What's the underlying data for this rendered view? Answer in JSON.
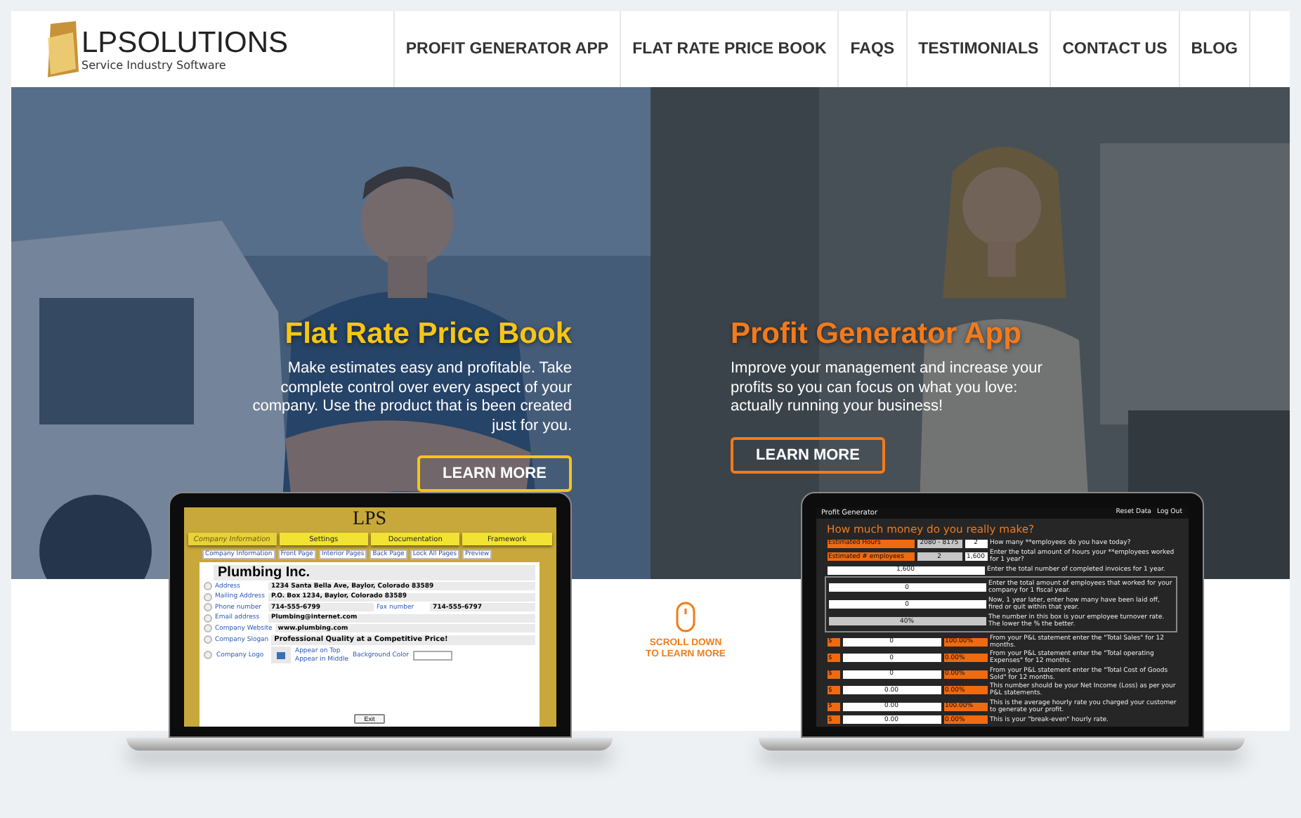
{
  "header": {
    "logo": {
      "wordmark": "LPSOLUTIONS",
      "tagline": "Service Industry Software"
    },
    "nav": [
      {
        "label": "PROFIT GENERATOR APP"
      },
      {
        "label": "FLAT RATE PRICE BOOK"
      },
      {
        "label": "FAQS"
      },
      {
        "label": "TESTIMONIALS"
      },
      {
        "label": "CONTACT US"
      },
      {
        "label": "BLOG"
      }
    ]
  },
  "hero": {
    "panels": [
      {
        "kind": "price_book",
        "title": "Flat Rate Price Book",
        "body": "Make estimates easy and profitable. Take complete control over every aspect of your company. Use the product that is been created just for you.",
        "button": "LEARN MORE"
      },
      {
        "kind": "profit_app",
        "title": "Profit Generator App",
        "body": "Improve your management and increase your profits so you can focus on what you love: actually running your business!",
        "button": "LEARN MORE"
      }
    ]
  },
  "scroll_hint": {
    "text": "SCROLL DOWN TO LEARN MORE"
  },
  "price_book_screen": {
    "heading": "LPS",
    "tabs": [
      {
        "label": "Company Information",
        "selected": true
      },
      {
        "label": "Settings",
        "selected": false
      },
      {
        "label": "Documentation",
        "selected": false
      },
      {
        "label": "Framework",
        "selected": false
      }
    ],
    "page_buttons": [
      "Company Information",
      "Front Page",
      "Interior Pages",
      "Back Page",
      "Lock All Pages",
      "Preview"
    ],
    "company": "Plumbing Inc.",
    "fields": [
      {
        "label": "Address",
        "value": "1234 Santa Bella Ave, Baylor, Colorado 83589"
      },
      {
        "label": "Mailing Address",
        "value": "P.O. Box 1234, Baylor, Colorado 83589"
      },
      {
        "label": "Phone number",
        "value": "714-555-6799",
        "label_2": "Fax number",
        "value_2": "714-555-6797"
      },
      {
        "label": "Email address",
        "value": "Plumbing@internet.com"
      },
      {
        "label": "Company Website",
        "value": "www.plumbing.com"
      },
      {
        "label": "Company Slogan",
        "value": "Professional Quality at a Competitive Price!"
      }
    ],
    "logo_row": {
      "label": "Company Logo",
      "options": [
        "Appear on Top",
        "Appear in Middle"
      ],
      "color_label": "Background Color"
    },
    "exit": "Exit"
  },
  "profit_screen": {
    "app_name": "Profit Generator",
    "links": [
      "Reset Data",
      "Log Out"
    ],
    "heading": "How much money do you really make?",
    "rows": [
      {
        "kind": "estimate",
        "label": "Estimated Hours",
        "value": "2080 - 8175",
        "input": "2",
        "text": "How many **employees do you have today?"
      },
      {
        "kind": "estimate",
        "label": "Estimated # employees",
        "value": "2",
        "input": "1,600",
        "text": "Enter the total amount of hours your **employees worked for 1 year?"
      },
      {
        "kind": "plain",
        "value": "1,600",
        "text": "Enter the total number of completed invoices for 1 year."
      }
    ],
    "box_rows": [
      {
        "kind": "plain",
        "value": "0",
        "text": "Enter the total amount of employees that worked for your company for 1 fiscal year."
      },
      {
        "kind": "plain",
        "value": "0",
        "text": "Now, 1 year later, enter how many have been laid off, fired or quit within that year."
      },
      {
        "kind": "result",
        "value": "40%",
        "text": "The number in this box is your employee turnover rate. The lower the % the better."
      }
    ],
    "money_rows": [
      {
        "value": "0",
        "percent": "100.00%",
        "text": "From your P&L statement enter the \"Total Sales\" for 12 months."
      },
      {
        "value": "0",
        "percent": "0.00%",
        "text": "From your P&L statement enter the \"Total operating Expenses\" for 12 months."
      },
      {
        "value": "0",
        "percent": "0.00%",
        "text": "From your P&L statement enter the \"Total Cost of Goods Sold\" for 12 months."
      },
      {
        "value": "0.00",
        "percent": "0.00%",
        "text": "This number should be your Net Income (Loss) as per your P&L statements."
      },
      {
        "value": "0.00",
        "percent": "100.00%",
        "text": "This is the average hourly rate you charged your customer to generate your profit."
      },
      {
        "value": "0.00",
        "percent": "0.00%",
        "text": "This is your \"break-even\" hourly rate."
      }
    ],
    "currency": "$"
  }
}
